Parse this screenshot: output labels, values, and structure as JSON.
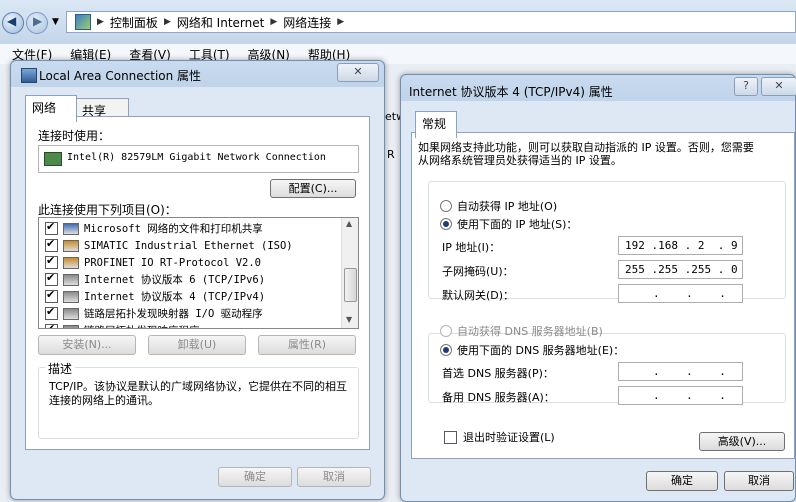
{
  "explorer": {
    "breadcrumb": [
      "控制面板",
      "网络和 Internet",
      "网络连接"
    ],
    "menu": [
      "文件(F)",
      "编辑(E)",
      "查看(V)",
      "工具(T)",
      "高级(N)",
      "帮助(H)"
    ],
    "partial_text": "etw",
    "partial_text2": "R"
  },
  "lac_dialog": {
    "title": "Local Area Connection 属性",
    "close": "✕",
    "tabs": [
      "网络",
      "共享"
    ],
    "connect_using_label": "连接时使用：",
    "adapter": "Intel(R) 82579LM Gigabit Network Connection",
    "configure_button": "配置(C)...",
    "items_label": "此连接使用下列项目(O)：",
    "items": [
      {
        "label": "Microsoft 网络的文件和打印机共享",
        "checked": true
      },
      {
        "label": "SIMATIC Industrial Ethernet (ISO)",
        "checked": true
      },
      {
        "label": "PROFINET IO RT-Protocol V2.0",
        "checked": true
      },
      {
        "label": "Internet 协议版本 6 (TCP/IPv6)",
        "checked": true
      },
      {
        "label": "Internet 协议版本 4 (TCP/IPv4)",
        "checked": true
      },
      {
        "label": "链路层拓扑发现映射器 I/O 驱动程序",
        "checked": true
      },
      {
        "label": "链路层拓扑发现响应程序",
        "checked": true
      }
    ],
    "install_button": "安装(N)...",
    "uninstall_button": "卸载(U)",
    "properties_button": "属性(R)",
    "description_label": "描述",
    "description": "TCP/IP。该协议是默认的广域网络协议，它提供在不同的相互连接的网络上的通讯。",
    "ok_button": "确定",
    "cancel_button": "取消"
  },
  "ipv4_dialog": {
    "title": "Internet 协议版本 4 (TCP/IPv4) 属性",
    "help": "?",
    "close": "✕",
    "tab": "常规",
    "intro": "如果网络支持此功能，则可以获取自动指派的 IP 设置。否则，您需要从网络系统管理员处获得适当的 IP 设置。",
    "auto_ip": "自动获得 IP 地址(O)",
    "manual_ip": "使用下面的 IP 地址(S)：",
    "ip_label": "IP 地址(I)：",
    "ip_value": "192 .168 . 2  . 9",
    "mask_label": "子网掩码(U)：",
    "mask_value": "255 .255 .255 . 0",
    "gateway_label": "默认网关(D)：",
    "gateway_value": ".    .    .",
    "auto_dns": "自动获得 DNS 服务器地址(B)",
    "manual_dns": "使用下面的 DNS 服务器地址(E)：",
    "pref_dns_label": "首选 DNS 服务器(P)：",
    "pref_dns_value": ".    .    .",
    "alt_dns_label": "备用 DNS 服务器(A)：",
    "alt_dns_value": ".    .    .",
    "validate_label": "退出时验证设置(L)",
    "advanced_button": "高级(V)...",
    "ok_button": "确定",
    "cancel_button": "取消"
  }
}
